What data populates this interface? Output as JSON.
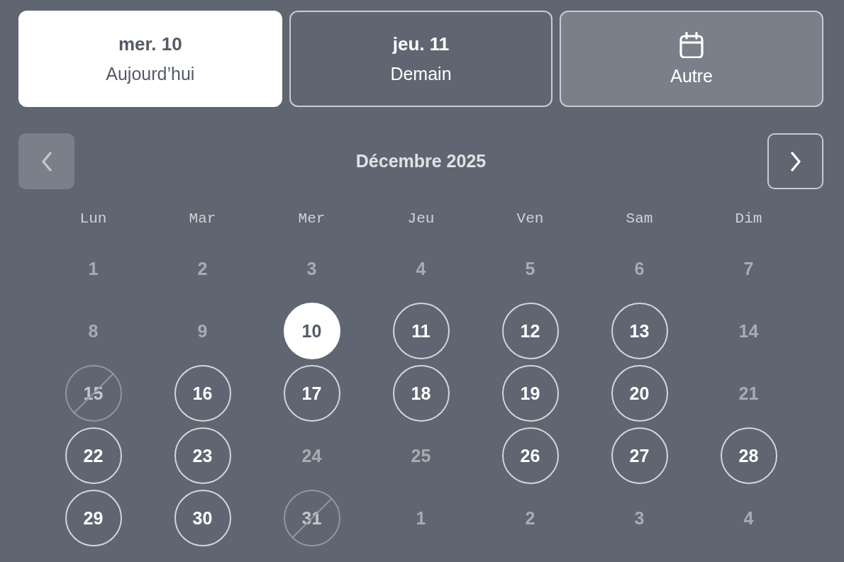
{
  "date_tabs": [
    {
      "kind": "date",
      "date": "mer. 10",
      "label": "Aujourd’hui",
      "selected": true
    },
    {
      "kind": "date",
      "date": "jeu. 11",
      "label": "Demain",
      "selected": false
    },
    {
      "kind": "other",
      "label": "Autre",
      "selected": false
    }
  ],
  "month_nav": {
    "title": "Décembre 2025",
    "prev": {
      "disabled": true
    },
    "next": {
      "disabled": false
    }
  },
  "weekdays": [
    "Lun",
    "Mar",
    "Mer",
    "Jeu",
    "Ven",
    "Sam",
    "Dim"
  ],
  "days": [
    {
      "label": "1",
      "kind": "unavailable",
      "selected": false
    },
    {
      "label": "2",
      "kind": "unavailable",
      "selected": false
    },
    {
      "label": "3",
      "kind": "unavailable",
      "selected": false
    },
    {
      "label": "4",
      "kind": "unavailable",
      "selected": false
    },
    {
      "label": "5",
      "kind": "unavailable",
      "selected": false
    },
    {
      "label": "6",
      "kind": "unavailable",
      "selected": false
    },
    {
      "label": "7",
      "kind": "unavailable",
      "selected": false
    },
    {
      "label": "8",
      "kind": "unavailable",
      "selected": false
    },
    {
      "label": "9",
      "kind": "unavailable",
      "selected": false
    },
    {
      "label": "10",
      "kind": "available",
      "selected": true
    },
    {
      "label": "11",
      "kind": "available",
      "selected": false
    },
    {
      "label": "12",
      "kind": "available",
      "selected": false
    },
    {
      "label": "13",
      "kind": "available",
      "selected": false
    },
    {
      "label": "14",
      "kind": "unavailable",
      "selected": false
    },
    {
      "label": "15",
      "kind": "blocked",
      "selected": false
    },
    {
      "label": "16",
      "kind": "available",
      "selected": false
    },
    {
      "label": "17",
      "kind": "available",
      "selected": false
    },
    {
      "label": "18",
      "kind": "available",
      "selected": false
    },
    {
      "label": "19",
      "kind": "available",
      "selected": false
    },
    {
      "label": "20",
      "kind": "available",
      "selected": false
    },
    {
      "label": "21",
      "kind": "unavailable",
      "selected": false
    },
    {
      "label": "22",
      "kind": "available",
      "selected": false
    },
    {
      "label": "23",
      "kind": "available",
      "selected": false
    },
    {
      "label": "24",
      "kind": "unavailable",
      "selected": false
    },
    {
      "label": "25",
      "kind": "unavailable",
      "selected": false
    },
    {
      "label": "26",
      "kind": "available",
      "selected": false
    },
    {
      "label": "27",
      "kind": "available",
      "selected": false
    },
    {
      "label": "28",
      "kind": "available",
      "selected": false
    },
    {
      "label": "29",
      "kind": "available",
      "selected": false
    },
    {
      "label": "30",
      "kind": "available",
      "selected": false
    },
    {
      "label": "31",
      "kind": "blocked",
      "selected": false
    },
    {
      "label": "1",
      "kind": "unavailable",
      "selected": false
    },
    {
      "label": "2",
      "kind": "unavailable",
      "selected": false
    },
    {
      "label": "3",
      "kind": "unavailable",
      "selected": false
    },
    {
      "label": "4",
      "kind": "unavailable",
      "selected": false
    }
  ]
}
